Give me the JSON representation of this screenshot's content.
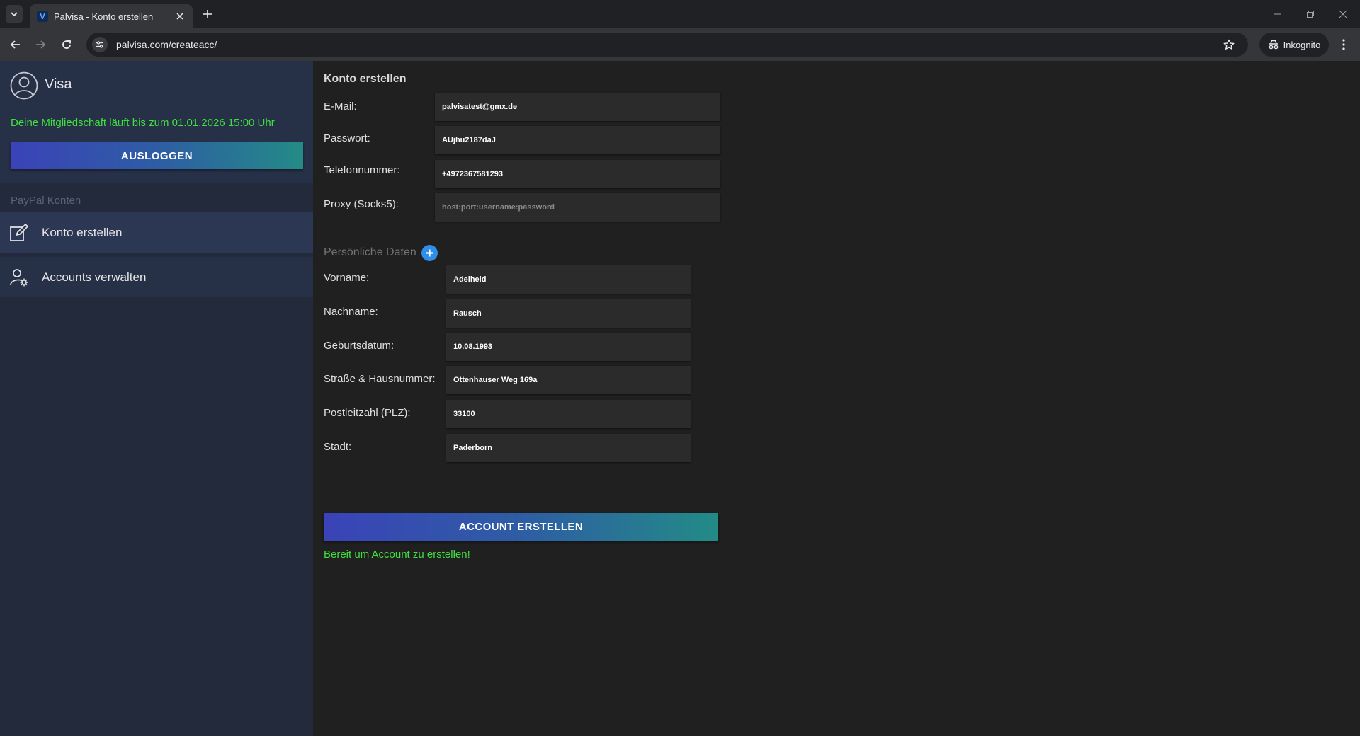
{
  "browser": {
    "tab_title": "Palvisa - Konto erstellen",
    "favicon_letter": "V",
    "url": "palvisa.com/createacc/",
    "incognito_label": "Inkognito"
  },
  "sidebar": {
    "user_name": "Visa",
    "membership_text": "Deine Mitgliedschaft läuft bis zum 01.01.2026 15:00 Uhr",
    "logout_label": "AUSLOGGEN",
    "section_label": "PayPal Konten",
    "items": [
      {
        "label": "Konto erstellen",
        "icon": "edit-icon",
        "active": true
      },
      {
        "label": "Accounts verwalten",
        "icon": "user-settings-icon",
        "active": false
      }
    ]
  },
  "form": {
    "heading": "Konto erstellen",
    "email": {
      "label": "E-Mail:",
      "value": "palvisatest@gmx.de"
    },
    "password": {
      "label": "Passwort:",
      "value": "AUjhu2187daJ"
    },
    "phone": {
      "label": "Telefonnummer:",
      "value": "+4972367581293"
    },
    "proxy": {
      "label": "Proxy (Socks5):",
      "value": "",
      "placeholder": "host:port:username:password"
    },
    "personal_heading": "Persönliche Daten",
    "firstname": {
      "label": "Vorname:",
      "value": "Adelheid"
    },
    "lastname": {
      "label": "Nachname:",
      "value": "Rausch"
    },
    "birthdate": {
      "label": "Geburtsdatum:",
      "value": "10.08.1993"
    },
    "street": {
      "label": "Straße & Hausnummer:",
      "value": "Ottenhauser Weg 169a"
    },
    "zip": {
      "label": "Postleitzahl (PLZ):",
      "value": "33100"
    },
    "city": {
      "label": "Stadt:",
      "value": "Paderborn"
    },
    "submit_label": "ACCOUNT ERSTELLEN",
    "status_text": "Bereit um Account zu erstellen!"
  },
  "colors": {
    "accent_green": "#3fe03f",
    "button_gradient_start": "#3a43b8",
    "button_gradient_end": "#238b86",
    "add_button_blue": "#2f8fe8"
  }
}
